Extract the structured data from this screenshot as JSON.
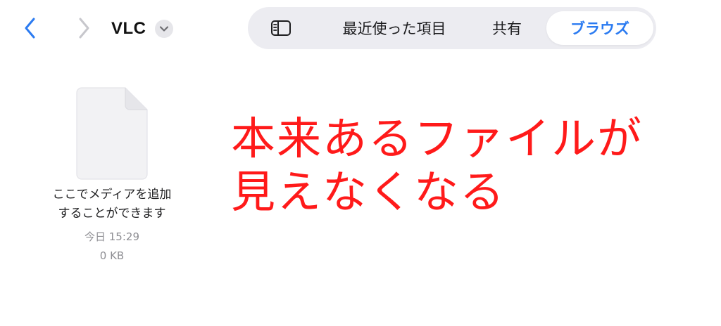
{
  "header": {
    "title": "VLC",
    "back_icon": "chevron-left-icon",
    "forward_icon": "chevron-right-icon",
    "title_menu_icon": "chevron-down-icon"
  },
  "segments": {
    "sidebar_icon": "sidebar-icon",
    "items": [
      {
        "label": "最近使った項目",
        "selected": false
      },
      {
        "label": "共有",
        "selected": false
      },
      {
        "label": "ブラウズ",
        "selected": true
      }
    ]
  },
  "file": {
    "icon": "document-icon",
    "name_line1": "ここでメディアを追加",
    "name_line2": "することができます",
    "date": "今日 15:29",
    "size": "0 KB"
  },
  "annotation": {
    "line1": "本来あるファイルが",
    "line2": "見えなくなる"
  },
  "colors": {
    "accent": "#2b7bf1",
    "annotation": "#ff1a1a",
    "segment_bg": "#ececf1",
    "secondary_text": "#8e8e93"
  }
}
